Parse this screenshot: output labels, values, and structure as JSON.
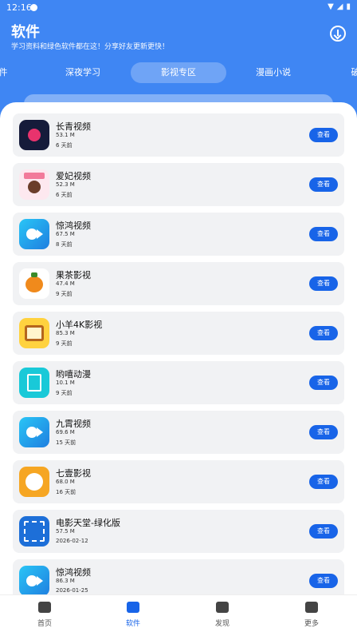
{
  "status": {
    "time": "12:16"
  },
  "header": {
    "title": "软件",
    "subtitle": "学习资料和绿色软件都在这！分享好友更新更快！"
  },
  "tabs": [
    {
      "label": "件"
    },
    {
      "label": "深夜学习"
    },
    {
      "label": "影视专区",
      "active": true
    },
    {
      "label": "漫画小说"
    },
    {
      "label": "破"
    }
  ],
  "button_label": "查看",
  "apps": [
    {
      "name": "长青视频",
      "size": "53.1 M",
      "date": "6 天前",
      "icon": "play-circle-icon"
    },
    {
      "name": "爱妃视频",
      "size": "52.3 M",
      "date": "6 天前",
      "icon": "girl-avatar-icon"
    },
    {
      "name": "惊鸿视频",
      "size": "67.5 M",
      "date": "8 天前",
      "icon": "camera-fish-icon"
    },
    {
      "name": "果茶影视",
      "size": "47.4 M",
      "date": "9 天前",
      "icon": "orange-fruit-icon"
    },
    {
      "name": "小羊4K影视",
      "size": "85.3 M",
      "date": "9 天前",
      "icon": "tv-sheep-icon"
    },
    {
      "name": "哟嘻动漫",
      "size": "10.1 M",
      "date": "9 天前",
      "icon": "pen-logo-icon"
    },
    {
      "name": "九霄视频",
      "size": "69.6 M",
      "date": "15 天前",
      "icon": "camera-fish-icon"
    },
    {
      "name": "七壹影视",
      "size": "68.0 M",
      "date": "16 天前",
      "icon": "lion-icon"
    },
    {
      "name": "电影天堂-绿化版",
      "size": "57.5 M",
      "date": "2026-02-12",
      "icon": "film-strip-icon"
    },
    {
      "name": "惊鸿视频",
      "size": "86.3 M",
      "date": "2026-01-25",
      "icon": "camera-fish-icon"
    }
  ],
  "nav": [
    {
      "label": "首页",
      "icon": "home-icon"
    },
    {
      "label": "软件",
      "icon": "apps-icon",
      "active": true
    },
    {
      "label": "发现",
      "icon": "discover-icon"
    },
    {
      "label": "更多",
      "icon": "more-icon"
    }
  ]
}
